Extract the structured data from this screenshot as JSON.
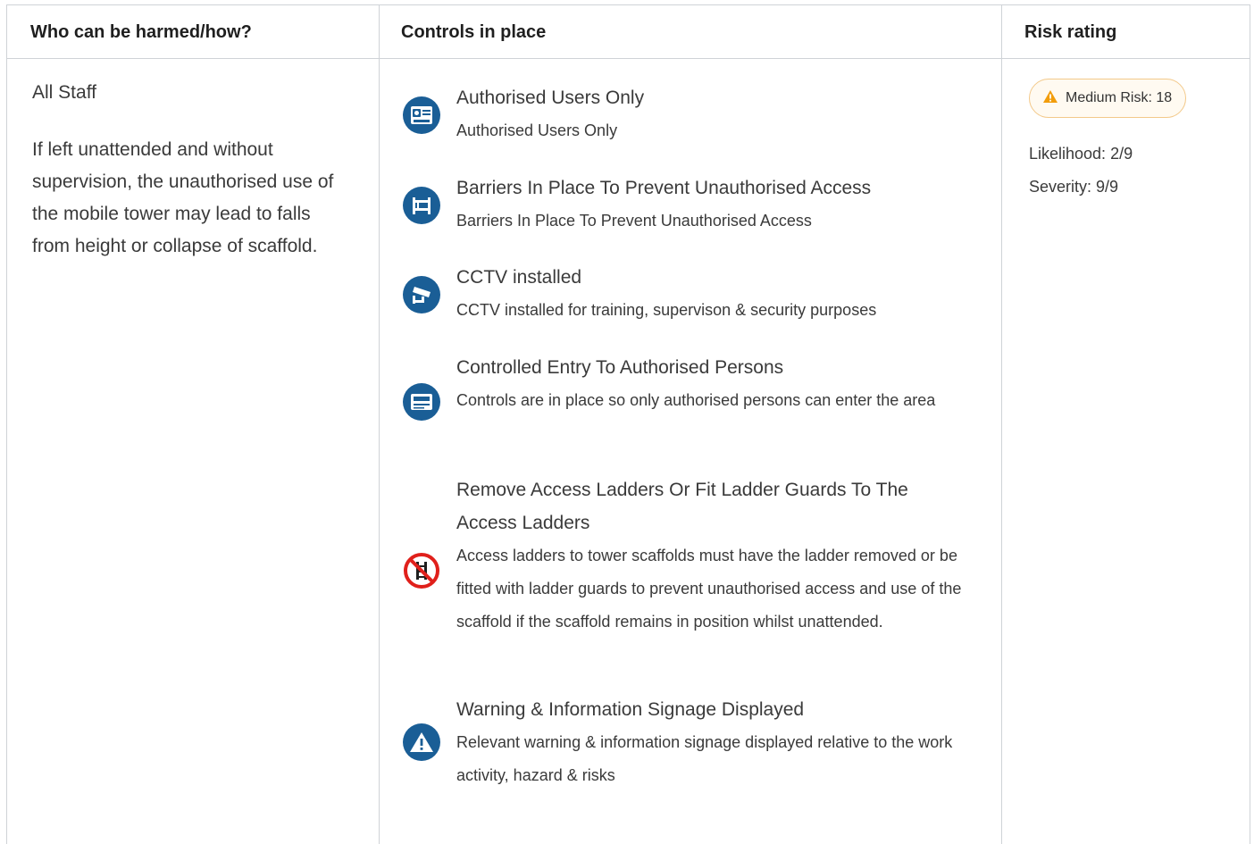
{
  "table": {
    "headers": {
      "who": "Who can be harmed/how?",
      "controls": "Controls in place",
      "risk": "Risk rating"
    }
  },
  "who": {
    "name": "All Staff",
    "description": "If left unattended and without supervision, the unauthorised use of the mobile tower may lead to falls from height or collapse of scaffold."
  },
  "controls": [
    {
      "title": "Authorised Users Only",
      "description": "Authorised Users Only",
      "icon": "pass-card-icon"
    },
    {
      "title": "Barriers In Place To Prevent Unauthorised Access",
      "description": "Barriers In Place To Prevent Unauthorised Access",
      "icon": "barrier-icon"
    },
    {
      "title": "CCTV installed",
      "description": "CCTV installed for training, supervison & security purposes",
      "icon": "cctv-camera-icon"
    },
    {
      "title": "Controlled Entry To Authorised Persons",
      "description": "Controls are in place so only authorised persons can enter the area",
      "icon": "pass-icon"
    },
    {
      "title": "Remove Access Ladders Or Fit Ladder Guards To The Access Ladders",
      "description": "Access ladders to tower scaffolds must have the ladder removed or be fitted with ladder guards to prevent unauthorised access and use of the scaffold if the scaffold remains in position whilst unattended.",
      "icon": "no-ladder-access-icon"
    },
    {
      "title": "Warning & Information Signage Displayed",
      "description": "Relevant warning & information signage displayed relative to the work activity, hazard & risks",
      "icon": "warning-sign-icon"
    }
  ],
  "risk": {
    "badge_label": "Medium Risk: 18",
    "badge_icon": "warning-triangle-icon",
    "likelihood": "Likelihood: 2/9",
    "severity": "Severity: 9/9"
  },
  "colors": {
    "icon_blue": "#1a5e96",
    "badge_border": "#f3c98a",
    "warning_orange": "#f29d0b",
    "prohibition_red": "#e0201b",
    "border": "#cfd3d7"
  }
}
